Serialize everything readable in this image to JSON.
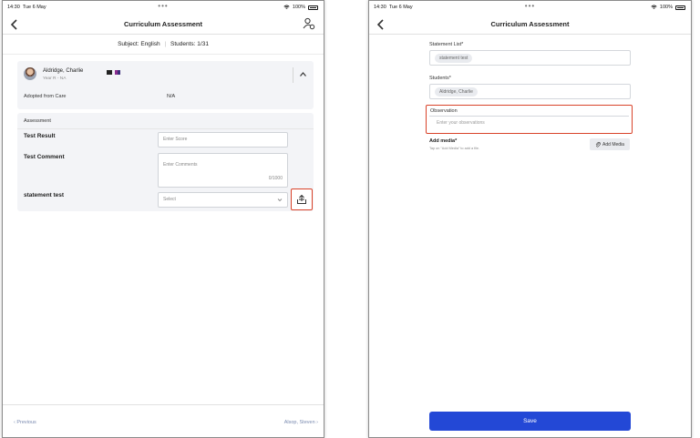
{
  "colors": {
    "accent_blue": "#2348d6",
    "highlight_red": "#d9432a",
    "card_bg": "#f3f4f7",
    "link_blue": "#7a8ab0"
  },
  "left_screen": {
    "status": {
      "time": "14:30",
      "date": "Tue 6 May",
      "battery": "100%",
      "dots": "•••"
    },
    "nav": {
      "title": "Curriculum Assessment",
      "back_icon": "chevron-left-icon",
      "action_icon": "person-settings-icon"
    },
    "subject_bar": {
      "subject": "Subject: English",
      "separator": "|",
      "students": "Students: 1/31"
    },
    "student_card": {
      "name": "Aldridge, Charlie",
      "year": "Year R - NA",
      "detail_label": "Adopted from Care",
      "detail_value": "N/A"
    },
    "assessment": {
      "heading": "Assessment",
      "test_result_label": "Test Result",
      "score_placeholder": "Enter Score",
      "test_comment_label": "Test Comment",
      "comment_placeholder": "Enter Comments",
      "comment_counter": "0/1000",
      "statement_label": "statement test",
      "select_placeholder": "Select",
      "upload_icon": "upload-icon"
    },
    "footer": {
      "previous": "‹  Previous",
      "next": "Alsop, Steven  ›"
    }
  },
  "right_screen": {
    "status": {
      "time": "14:30",
      "date": "Tue 6 May",
      "battery": "100%",
      "dots": "•••"
    },
    "nav": {
      "title": "Curriculum Assessment",
      "back_icon": "chevron-left-icon"
    },
    "form": {
      "statement_list_label": "Statement List*",
      "statement_chip": "statement test",
      "students_label": "Students*",
      "student_chip": "Aldridge, Charlie",
      "observation_label": "Observation",
      "observation_placeholder": "Enter your observations",
      "add_media_title": "Add media*",
      "add_media_hint": "Tap on \"Add Media\" to add a file.",
      "add_media_button": "Add Media",
      "save_button": "Save"
    }
  }
}
